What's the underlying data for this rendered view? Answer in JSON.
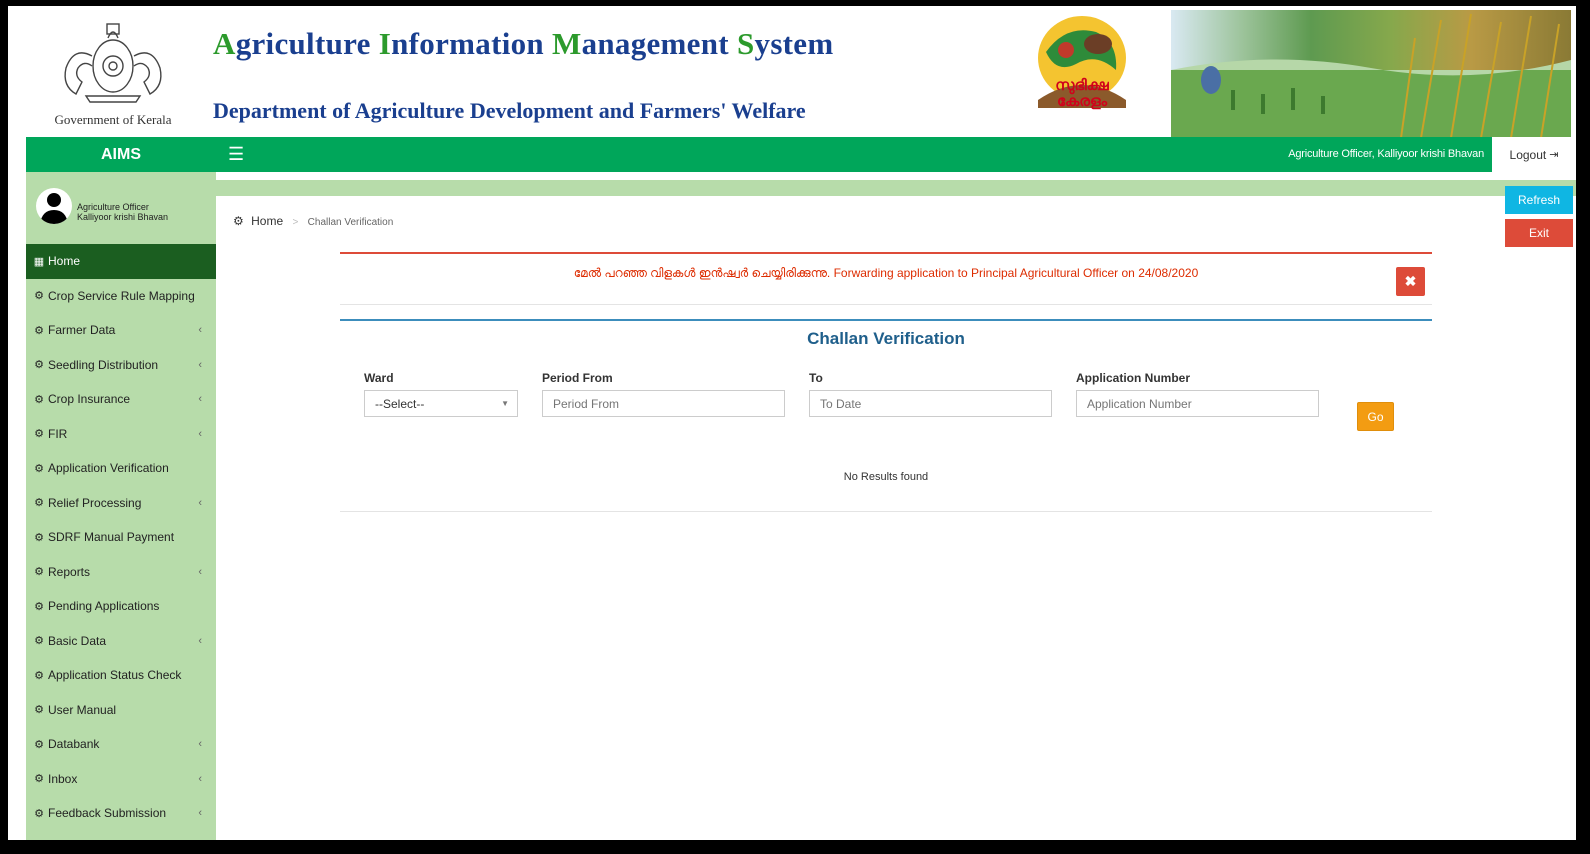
{
  "header": {
    "emblem_label": "Government of Kerala",
    "title_parts": [
      {
        "initial": "A",
        "rest": "griculture "
      },
      {
        "initial": "I",
        "rest": "nformation "
      },
      {
        "initial": "M",
        "rest": "anagement "
      },
      {
        "initial": "S",
        "rest": "ystem"
      }
    ],
    "subtitle": "Department of Agriculture Development and Farmers' Welfare",
    "logo_text": "സുഭിക്ഷ കേരളം"
  },
  "topbar": {
    "brand": "AIMS",
    "menu_icon": "☰",
    "user_role": "Agriculture Officer, Kalliyoor krishi Bhavan",
    "logout_label": "Logout",
    "logout_icon": "⇥"
  },
  "sidebar": {
    "user_line1": "Agriculture Officer",
    "user_line2": "Kalliyoor krishi Bhavan",
    "items": [
      {
        "label": "Home",
        "icon": "▦",
        "active": true,
        "submenu": false
      },
      {
        "label": "Crop Service Rule Mapping",
        "icon": "⚙",
        "active": false,
        "submenu": false
      },
      {
        "label": "Farmer Data",
        "icon": "⚙",
        "active": false,
        "submenu": true
      },
      {
        "label": "Seedling Distribution",
        "icon": "⚙",
        "active": false,
        "submenu": true
      },
      {
        "label": "Crop Insurance",
        "icon": "⚙",
        "active": false,
        "submenu": true
      },
      {
        "label": "FIR",
        "icon": "⚙",
        "active": false,
        "submenu": true
      },
      {
        "label": "Application Verification",
        "icon": "⚙",
        "active": false,
        "submenu": false
      },
      {
        "label": "Relief Processing",
        "icon": "⚙",
        "active": false,
        "submenu": true
      },
      {
        "label": "SDRF Manual Payment",
        "icon": "⚙",
        "active": false,
        "submenu": false
      },
      {
        "label": "Reports",
        "icon": "⚙",
        "active": false,
        "submenu": true
      },
      {
        "label": "Pending Applications",
        "icon": "⚙",
        "active": false,
        "submenu": false
      },
      {
        "label": "Basic Data",
        "icon": "⚙",
        "active": false,
        "submenu": true
      },
      {
        "label": "Application Status Check",
        "icon": "⚙",
        "active": false,
        "submenu": false
      },
      {
        "label": "User Manual",
        "icon": "⚙",
        "active": false,
        "submenu": false
      },
      {
        "label": "Databank",
        "icon": "⚙",
        "active": false,
        "submenu": true
      },
      {
        "label": "Inbox",
        "icon": "⚙",
        "active": false,
        "submenu": true
      },
      {
        "label": "Feedback Submission",
        "icon": "⚙",
        "active": false,
        "submenu": true
      }
    ]
  },
  "side_buttons": {
    "refresh": "Refresh",
    "exit": "Exit"
  },
  "breadcrumb": {
    "icon": "⚙",
    "home": "Home",
    "separator": ">",
    "current": "Challan Verification"
  },
  "alert": {
    "message": "മേൽ പറഞ്ഞ വിളകൾ ഇൻഷ്വർ ചെയ്യിരിക്കുന്നു. Forwarding application to Principal Agricultural Officer on 24/08/2020",
    "close_icon": "✖"
  },
  "form": {
    "title": "Challan Verification",
    "ward_label": "Ward",
    "ward_value": "--Select--",
    "period_from_label": "Period From",
    "period_from_placeholder": "Period From",
    "to_label": "To",
    "to_placeholder": "To Date",
    "app_number_label": "Application Number",
    "app_number_placeholder": "Application Number",
    "go_label": "Go",
    "no_results": "No Results found"
  },
  "colors": {
    "primary_green": "#00a65a",
    "sidebar_bg": "#b7dcaa",
    "active_item": "#1b5e20",
    "title_blue": "#1a3f8f",
    "alert_red": "#dd4b39",
    "refresh_cyan": "#0fb6e3",
    "go_orange": "#f39c12"
  }
}
